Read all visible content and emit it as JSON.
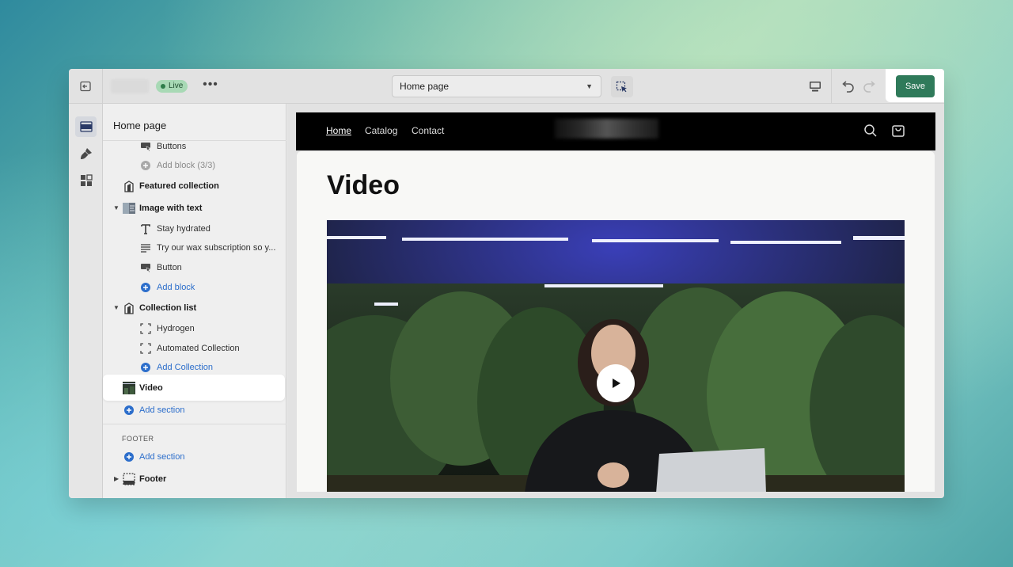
{
  "topbar": {
    "status_badge": "Live",
    "more_label": "•••",
    "page_select_value": "Home page",
    "save_label": "Save"
  },
  "sidebar": {
    "title": "Home page",
    "items": [
      {
        "label": "Buttons"
      },
      {
        "label": "Add block (3/3)"
      },
      {
        "label": "Featured collection"
      },
      {
        "label": "Image with text"
      },
      {
        "label": "Stay hydrated"
      },
      {
        "label": "Try our wax subscription so y..."
      },
      {
        "label": "Button"
      },
      {
        "label": "Add block"
      },
      {
        "label": "Collection list"
      },
      {
        "label": "Hydrogen"
      },
      {
        "label": "Automated Collection"
      },
      {
        "label": "Add Collection"
      },
      {
        "label": "Video"
      },
      {
        "label": "Add section"
      }
    ],
    "footer_heading": "FOOTER",
    "footer_add_section": "Add section",
    "footer_item": "Footer"
  },
  "preview": {
    "nav": [
      {
        "label": "Home"
      },
      {
        "label": "Catalog"
      },
      {
        "label": "Contact"
      }
    ],
    "section_title": "Video"
  },
  "colors": {
    "save_button": "#2f7a5a",
    "live_badge": "#a8d9b5",
    "link": "#2c6ecb"
  }
}
